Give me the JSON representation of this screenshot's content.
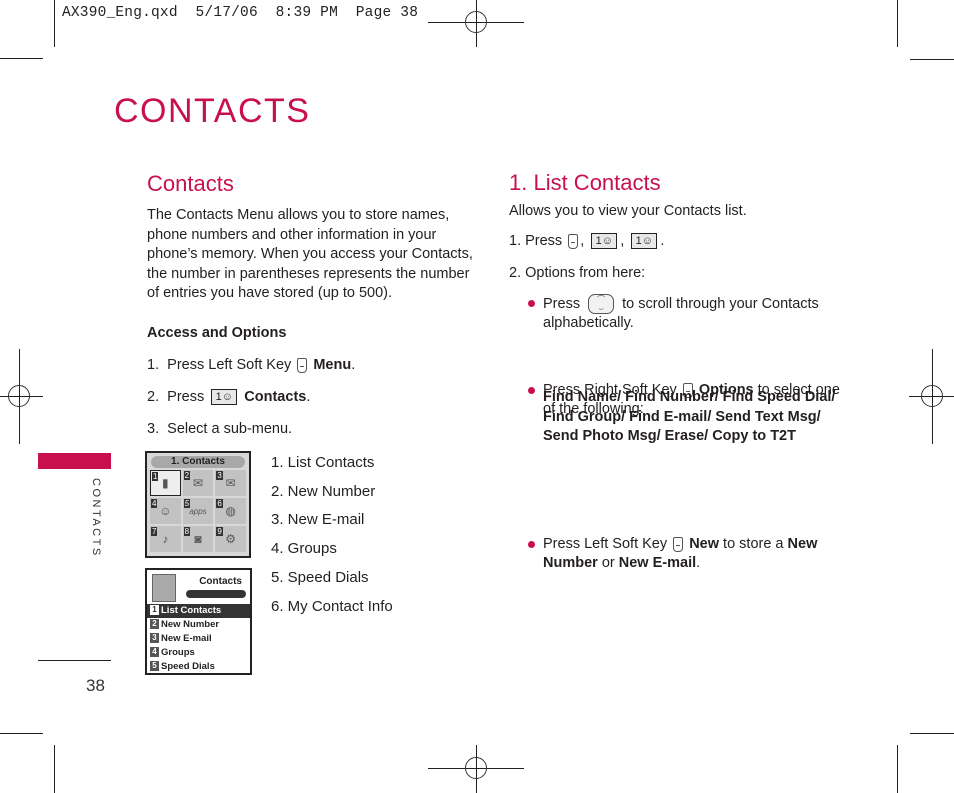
{
  "slug": {
    "file": "AX390_Eng.qxd",
    "date": "5/17/06",
    "time": "8:39 PM",
    "page": "Page 38"
  },
  "page_title": "CONTACTS",
  "side_tab": {
    "label": "CONTACTS",
    "color": "#c8104f"
  },
  "page_number": "38",
  "left": {
    "heading": "Contacts",
    "intro": "The Contacts Menu allows you to store names, phone numbers and other information in your phone’s memory. When you access your Contacts, the number in parentheses represents the number of entries you have stored (up to 500).",
    "access_heading": "Access and Options",
    "steps": [
      {
        "num": "1.",
        "text": "Press Left Soft Key",
        "key": "left-soft-key",
        "bold": "Menu",
        "end": "."
      },
      {
        "num": "2.",
        "text": "Press",
        "key": "1-contacts-key",
        "bold": "Contacts",
        "end": "."
      },
      {
        "num": "3.",
        "text": "Select a sub-menu.",
        "key": "",
        "bold": "",
        "end": ""
      }
    ],
    "screen1": {
      "title": "1. Contacts",
      "cells": [
        {
          "n": "1",
          "icon": "contacts-book-icon"
        },
        {
          "n": "2",
          "icon": "messages-icon"
        },
        {
          "n": "3",
          "icon": "email-icon"
        },
        {
          "n": "4",
          "icon": "smiley-icon"
        },
        {
          "n": "5",
          "icon": "apps-icon",
          "label": "apps"
        },
        {
          "n": "6",
          "icon": "web-globe-icon"
        },
        {
          "n": "7",
          "icon": "music-icon"
        },
        {
          "n": "8",
          "icon": "camera-icon"
        },
        {
          "n": "9",
          "icon": "settings-gears-icon"
        }
      ]
    },
    "screen2": {
      "title": "Contacts",
      "items": [
        {
          "n": "1",
          "label": "List Contacts"
        },
        {
          "n": "2",
          "label": "New Number"
        },
        {
          "n": "3",
          "label": "New E-mail"
        },
        {
          "n": "4",
          "label": "Groups"
        },
        {
          "n": "5",
          "label": "Speed Dials"
        }
      ]
    },
    "submenu": [
      "1. List Contacts",
      "2. New Number",
      "3. New E-mail",
      "4. Groups",
      "5. Speed Dials",
      "6. My Contact Info"
    ]
  },
  "right": {
    "heading": "1. List Contacts",
    "intro": "Allows you to view your Contacts list.",
    "step1": "1. Press",
    "step2": "2. Options from here:",
    "key_digit": "1",
    "bullets": {
      "b1_a": "Press",
      "b1_b": "to scroll through your Contacts alphabetically.",
      "b2_a": "Press Right Soft Key",
      "b2_bold": "Options",
      "b2_b": "to select one of the following:",
      "options": "Find Name/ Find Number/ Find Speed Dial/ Find Group/ Find E-mail/ Send Text Msg/ Send Photo Msg/ Erase/ Copy to T2T",
      "b3_a": "Press Left Soft Key",
      "b3_bold1": "New",
      "b3_b": "to store a",
      "b3_bold2": "New Number",
      "b3_c": "or",
      "b3_bold3": "New E-mail",
      "b3_end": "."
    }
  }
}
